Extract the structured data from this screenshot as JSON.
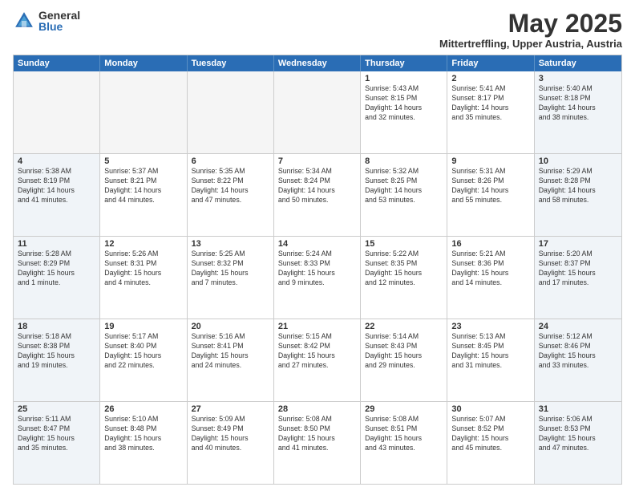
{
  "logo": {
    "general": "General",
    "blue": "Blue"
  },
  "header": {
    "month": "May 2025",
    "location": "Mittertreffling, Upper Austria, Austria"
  },
  "days": [
    "Sunday",
    "Monday",
    "Tuesday",
    "Wednesday",
    "Thursday",
    "Friday",
    "Saturday"
  ],
  "weeks": [
    [
      {
        "day": "",
        "text": "",
        "empty": true
      },
      {
        "day": "",
        "text": "",
        "empty": true
      },
      {
        "day": "",
        "text": "",
        "empty": true
      },
      {
        "day": "",
        "text": "",
        "empty": true
      },
      {
        "day": "1",
        "text": "Sunrise: 5:43 AM\nSunset: 8:15 PM\nDaylight: 14 hours\nand 32 minutes."
      },
      {
        "day": "2",
        "text": "Sunrise: 5:41 AM\nSunset: 8:17 PM\nDaylight: 14 hours\nand 35 minutes."
      },
      {
        "day": "3",
        "text": "Sunrise: 5:40 AM\nSunset: 8:18 PM\nDaylight: 14 hours\nand 38 minutes."
      }
    ],
    [
      {
        "day": "4",
        "text": "Sunrise: 5:38 AM\nSunset: 8:19 PM\nDaylight: 14 hours\nand 41 minutes."
      },
      {
        "day": "5",
        "text": "Sunrise: 5:37 AM\nSunset: 8:21 PM\nDaylight: 14 hours\nand 44 minutes."
      },
      {
        "day": "6",
        "text": "Sunrise: 5:35 AM\nSunset: 8:22 PM\nDaylight: 14 hours\nand 47 minutes."
      },
      {
        "day": "7",
        "text": "Sunrise: 5:34 AM\nSunset: 8:24 PM\nDaylight: 14 hours\nand 50 minutes."
      },
      {
        "day": "8",
        "text": "Sunrise: 5:32 AM\nSunset: 8:25 PM\nDaylight: 14 hours\nand 53 minutes."
      },
      {
        "day": "9",
        "text": "Sunrise: 5:31 AM\nSunset: 8:26 PM\nDaylight: 14 hours\nand 55 minutes."
      },
      {
        "day": "10",
        "text": "Sunrise: 5:29 AM\nSunset: 8:28 PM\nDaylight: 14 hours\nand 58 minutes."
      }
    ],
    [
      {
        "day": "11",
        "text": "Sunrise: 5:28 AM\nSunset: 8:29 PM\nDaylight: 15 hours\nand 1 minute."
      },
      {
        "day": "12",
        "text": "Sunrise: 5:26 AM\nSunset: 8:31 PM\nDaylight: 15 hours\nand 4 minutes."
      },
      {
        "day": "13",
        "text": "Sunrise: 5:25 AM\nSunset: 8:32 PM\nDaylight: 15 hours\nand 7 minutes."
      },
      {
        "day": "14",
        "text": "Sunrise: 5:24 AM\nSunset: 8:33 PM\nDaylight: 15 hours\nand 9 minutes."
      },
      {
        "day": "15",
        "text": "Sunrise: 5:22 AM\nSunset: 8:35 PM\nDaylight: 15 hours\nand 12 minutes."
      },
      {
        "day": "16",
        "text": "Sunrise: 5:21 AM\nSunset: 8:36 PM\nDaylight: 15 hours\nand 14 minutes."
      },
      {
        "day": "17",
        "text": "Sunrise: 5:20 AM\nSunset: 8:37 PM\nDaylight: 15 hours\nand 17 minutes."
      }
    ],
    [
      {
        "day": "18",
        "text": "Sunrise: 5:18 AM\nSunset: 8:38 PM\nDaylight: 15 hours\nand 19 minutes."
      },
      {
        "day": "19",
        "text": "Sunrise: 5:17 AM\nSunset: 8:40 PM\nDaylight: 15 hours\nand 22 minutes."
      },
      {
        "day": "20",
        "text": "Sunrise: 5:16 AM\nSunset: 8:41 PM\nDaylight: 15 hours\nand 24 minutes."
      },
      {
        "day": "21",
        "text": "Sunrise: 5:15 AM\nSunset: 8:42 PM\nDaylight: 15 hours\nand 27 minutes."
      },
      {
        "day": "22",
        "text": "Sunrise: 5:14 AM\nSunset: 8:43 PM\nDaylight: 15 hours\nand 29 minutes."
      },
      {
        "day": "23",
        "text": "Sunrise: 5:13 AM\nSunset: 8:45 PM\nDaylight: 15 hours\nand 31 minutes."
      },
      {
        "day": "24",
        "text": "Sunrise: 5:12 AM\nSunset: 8:46 PM\nDaylight: 15 hours\nand 33 minutes."
      }
    ],
    [
      {
        "day": "25",
        "text": "Sunrise: 5:11 AM\nSunset: 8:47 PM\nDaylight: 15 hours\nand 35 minutes."
      },
      {
        "day": "26",
        "text": "Sunrise: 5:10 AM\nSunset: 8:48 PM\nDaylight: 15 hours\nand 38 minutes."
      },
      {
        "day": "27",
        "text": "Sunrise: 5:09 AM\nSunset: 8:49 PM\nDaylight: 15 hours\nand 40 minutes."
      },
      {
        "day": "28",
        "text": "Sunrise: 5:08 AM\nSunset: 8:50 PM\nDaylight: 15 hours\nand 41 minutes."
      },
      {
        "day": "29",
        "text": "Sunrise: 5:08 AM\nSunset: 8:51 PM\nDaylight: 15 hours\nand 43 minutes."
      },
      {
        "day": "30",
        "text": "Sunrise: 5:07 AM\nSunset: 8:52 PM\nDaylight: 15 hours\nand 45 minutes."
      },
      {
        "day": "31",
        "text": "Sunrise: 5:06 AM\nSunset: 8:53 PM\nDaylight: 15 hours\nand 47 minutes."
      }
    ]
  ]
}
